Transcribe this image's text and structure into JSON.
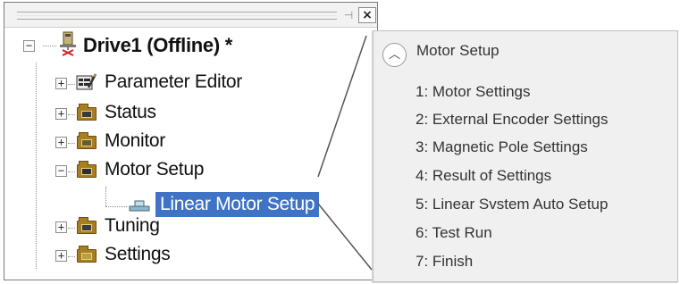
{
  "tree_panel": {
    "pin_glyph": "⊣",
    "close_glyph": "×",
    "root": {
      "label": "Drive1 (Offline) *",
      "expanded": true
    },
    "items": [
      {
        "label": "Parameter Editor",
        "icon": "parameter-editor-icon",
        "toggle": "+"
      },
      {
        "label": "Status",
        "icon": "status-folder-icon",
        "toggle": "+"
      },
      {
        "label": "Monitor",
        "icon": "monitor-folder-icon",
        "toggle": "+"
      },
      {
        "label": "Motor Setup",
        "icon": "motor-setup-folder-icon",
        "toggle": "−"
      },
      {
        "label": "Tuning",
        "icon": "tuning-folder-icon",
        "toggle": "+"
      },
      {
        "label": "Settings",
        "icon": "settings-folder-icon",
        "toggle": "+"
      }
    ],
    "selected_child": {
      "label": "Linear Motor Setup",
      "icon": "linear-motor-icon",
      "parent": "Motor Setup"
    },
    "selection_color": "#3e73c6"
  },
  "popup": {
    "collapse_glyph": "︿",
    "title": "Motor Setup",
    "steps": [
      "1: Motor Settings",
      "2: External Encoder Settings",
      "3: Magnetic Pole Settings",
      "4: Result of Settings",
      "5: Linear Svstem Auto Setup",
      "6: Test Run",
      "7: Finish"
    ]
  }
}
